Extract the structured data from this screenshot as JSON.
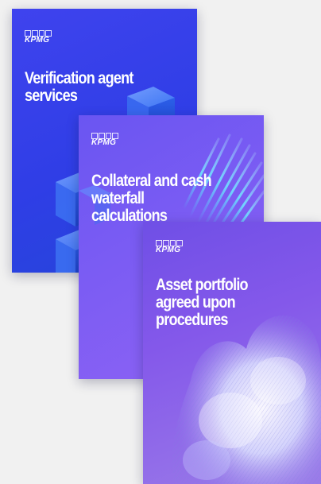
{
  "brand": {
    "logo_text": "KPMG"
  },
  "cards": [
    {
      "title_lines": [
        "Verification agent",
        "services"
      ]
    },
    {
      "title_lines": [
        "Collateral and cash",
        "waterfall",
        "calculations"
      ]
    },
    {
      "title_lines": [
        "Asset portfolio",
        "agreed upon",
        "procedures"
      ]
    }
  ],
  "colors": {
    "background": "#f1f1f1",
    "card_1": "#2f3ee6",
    "card_2": "#7b5cf3",
    "card_3": "#8458ea",
    "text": "#ffffff"
  }
}
